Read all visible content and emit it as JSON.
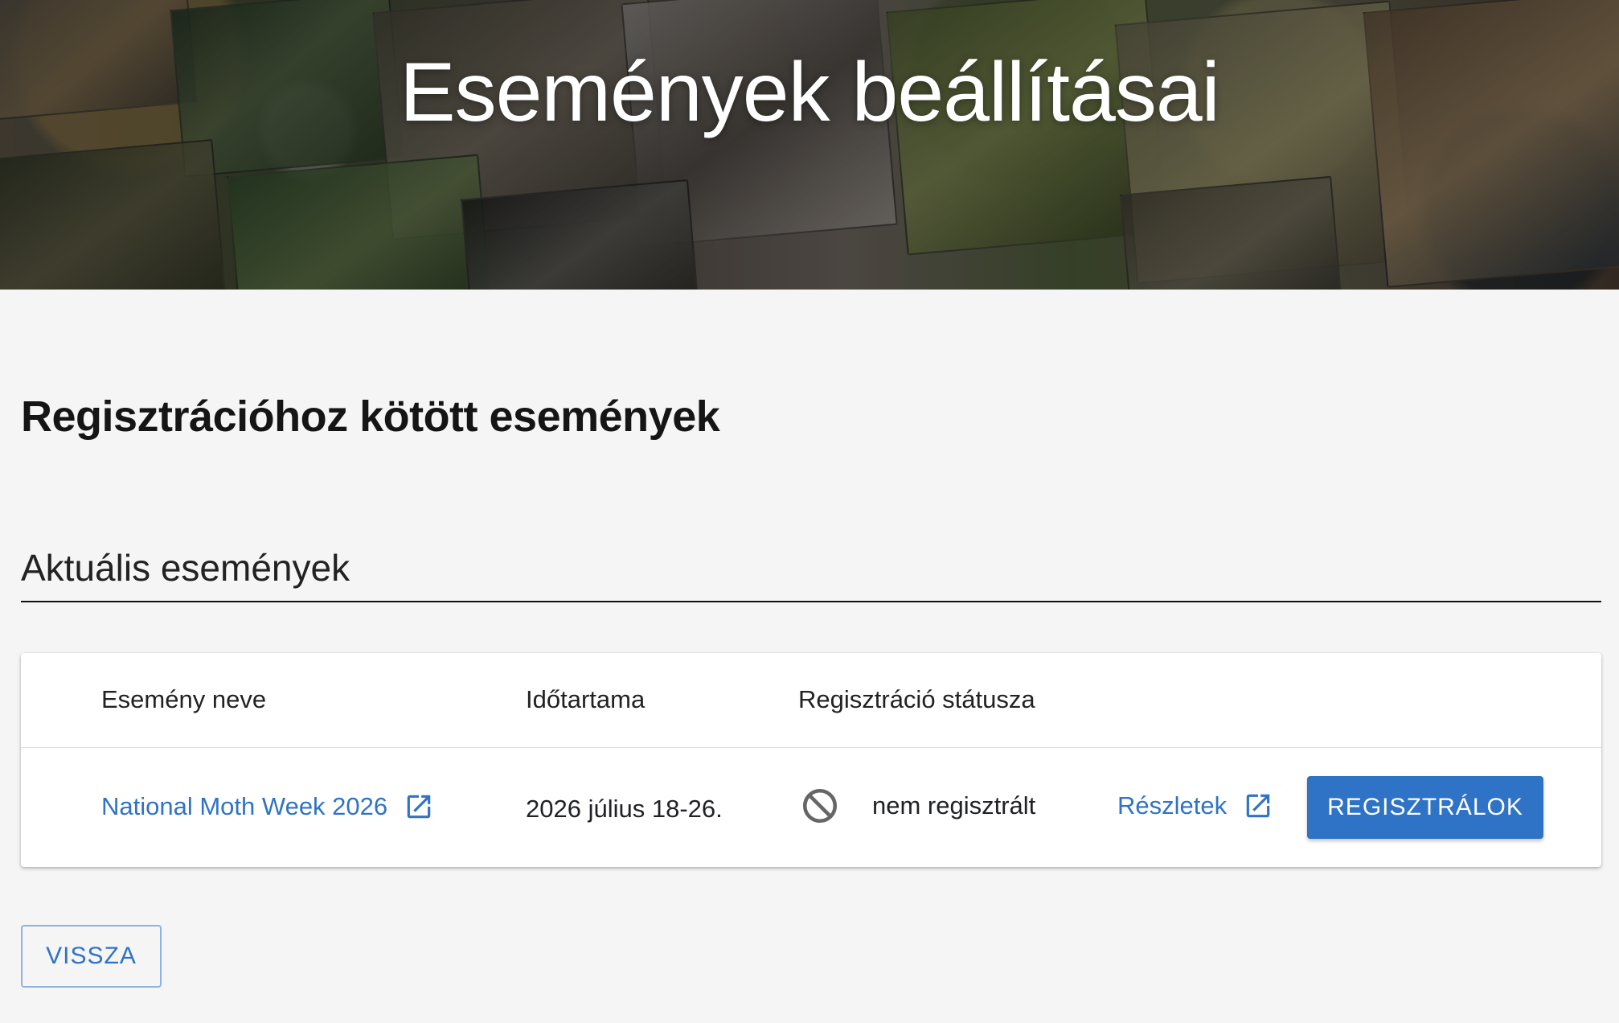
{
  "header": {
    "title": "Események beállításai"
  },
  "main": {
    "section_title": "Regisztrációhoz kötött események",
    "subsection_title": "Aktuális események",
    "table": {
      "headers": {
        "event_name": "Esemény neve",
        "duration": "Időtartama",
        "registration_status": "Regisztráció státusza"
      },
      "rows": [
        {
          "event_name": "National Moth Week 2026",
          "duration": "2026 július 18-26.",
          "status": "nem regisztrált",
          "details_label": "Részletek",
          "register_label": "REGISZTRÁLOK",
          "event_link_icon": "open-in-new-icon",
          "status_icon": "block-icon",
          "details_link_icon": "open-in-new-icon"
        }
      ]
    },
    "back_label": "VISSZA"
  },
  "colors": {
    "accent": "#2f73c6",
    "page_background": "#f5f5f5",
    "card_background": "#ffffff",
    "text": "#202124"
  }
}
